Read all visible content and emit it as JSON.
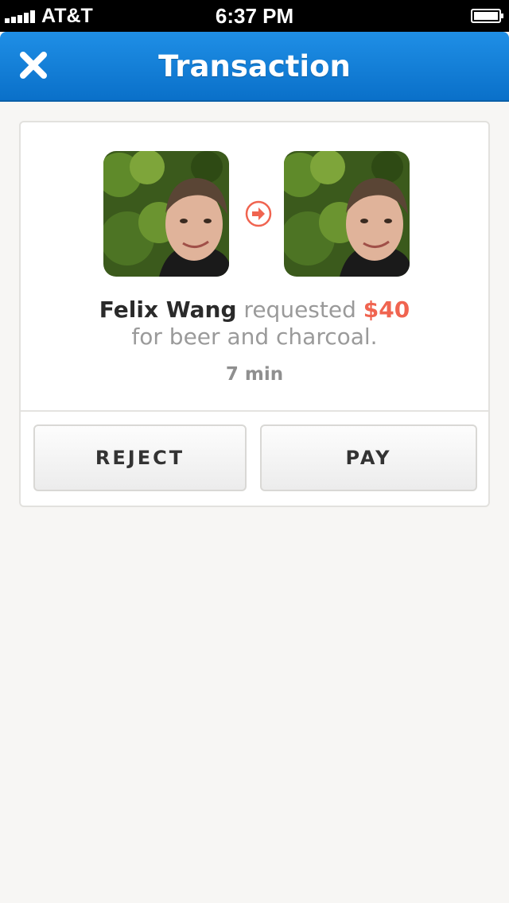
{
  "status_bar": {
    "carrier": "AT&T",
    "time": "6:37 PM",
    "signal_bars": 5,
    "battery_level": 1.0
  },
  "nav": {
    "title": "Transaction",
    "close_icon": "close-x-icon"
  },
  "transaction": {
    "sender_name": "Felix Wang",
    "verb": "requested",
    "amount": "$40",
    "note": "for beer and charcoal.",
    "time_ago": "7 min",
    "arrow_icon": "circle-arrow-right-icon"
  },
  "actions": {
    "reject_label": "REJECT",
    "pay_label": "PAY"
  },
  "colors": {
    "nav_blue": "#0a78d0",
    "accent_red": "#f06450",
    "background": "#f7f6f4"
  }
}
